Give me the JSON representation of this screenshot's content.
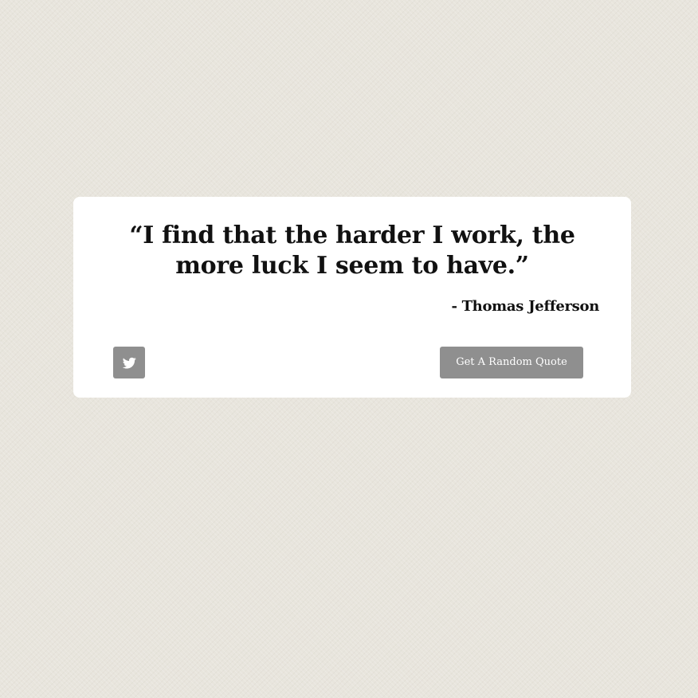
{
  "quote": {
    "text": "“I find that the harder I work, the more luck I seem to have.”",
    "author": "- Thomas Jefferson"
  },
  "actions": {
    "tweet_icon": "twitter-icon",
    "new_quote_label": "Get A Random Quote"
  },
  "colors": {
    "background": "#e8e5dd",
    "card": "#ffffff",
    "button": "#8f8f8f",
    "text": "#111111"
  }
}
